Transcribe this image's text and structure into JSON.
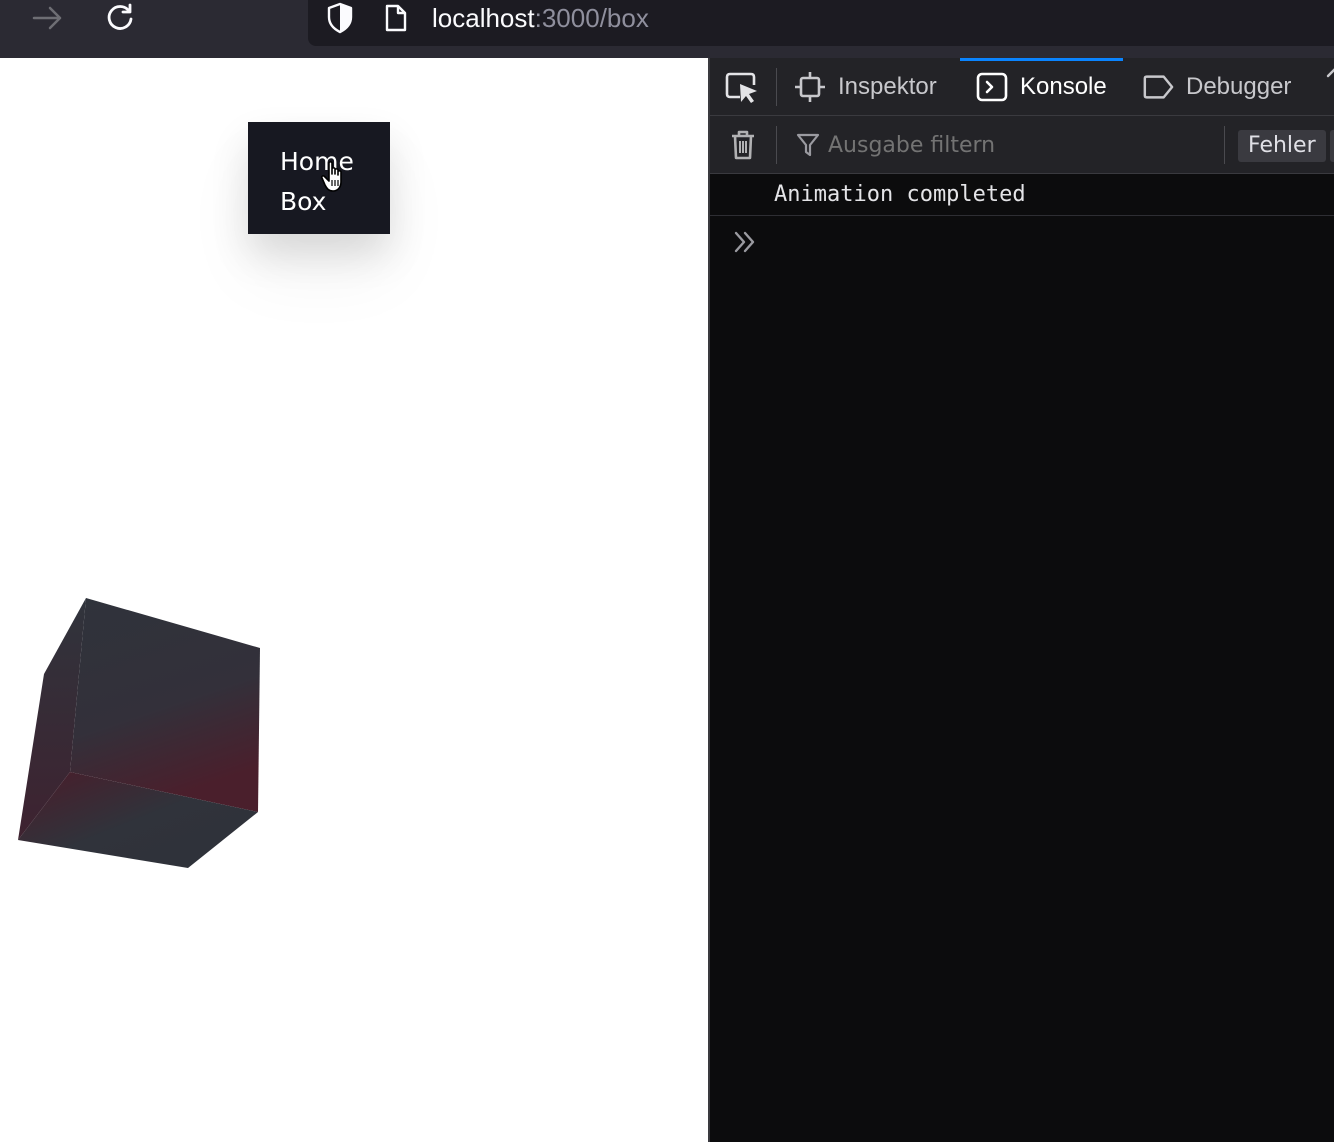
{
  "browser": {
    "url_host": "localhost",
    "url_path": ":3000/box"
  },
  "page": {
    "nav": {
      "items": [
        {
          "label": "Home"
        },
        {
          "label": "Box"
        }
      ]
    },
    "colors": {
      "menu_bg": "#171821",
      "cube_face": "#2e3038",
      "cube_accent": "#5a1a26"
    }
  },
  "devtools": {
    "tabs": [
      {
        "label": "Inspektor",
        "icon": "inspector-icon"
      },
      {
        "label": "Konsole",
        "icon": "console-icon",
        "active": true
      },
      {
        "label": "Debugger",
        "icon": "debugger-icon"
      }
    ],
    "filter": {
      "placeholder": "Ausgabe filtern",
      "value": ""
    },
    "levels": {
      "errors_label": "Fehler"
    },
    "console": {
      "messages": [
        {
          "text": "Animation completed"
        }
      ]
    },
    "accent_color": "#0a84ff"
  }
}
